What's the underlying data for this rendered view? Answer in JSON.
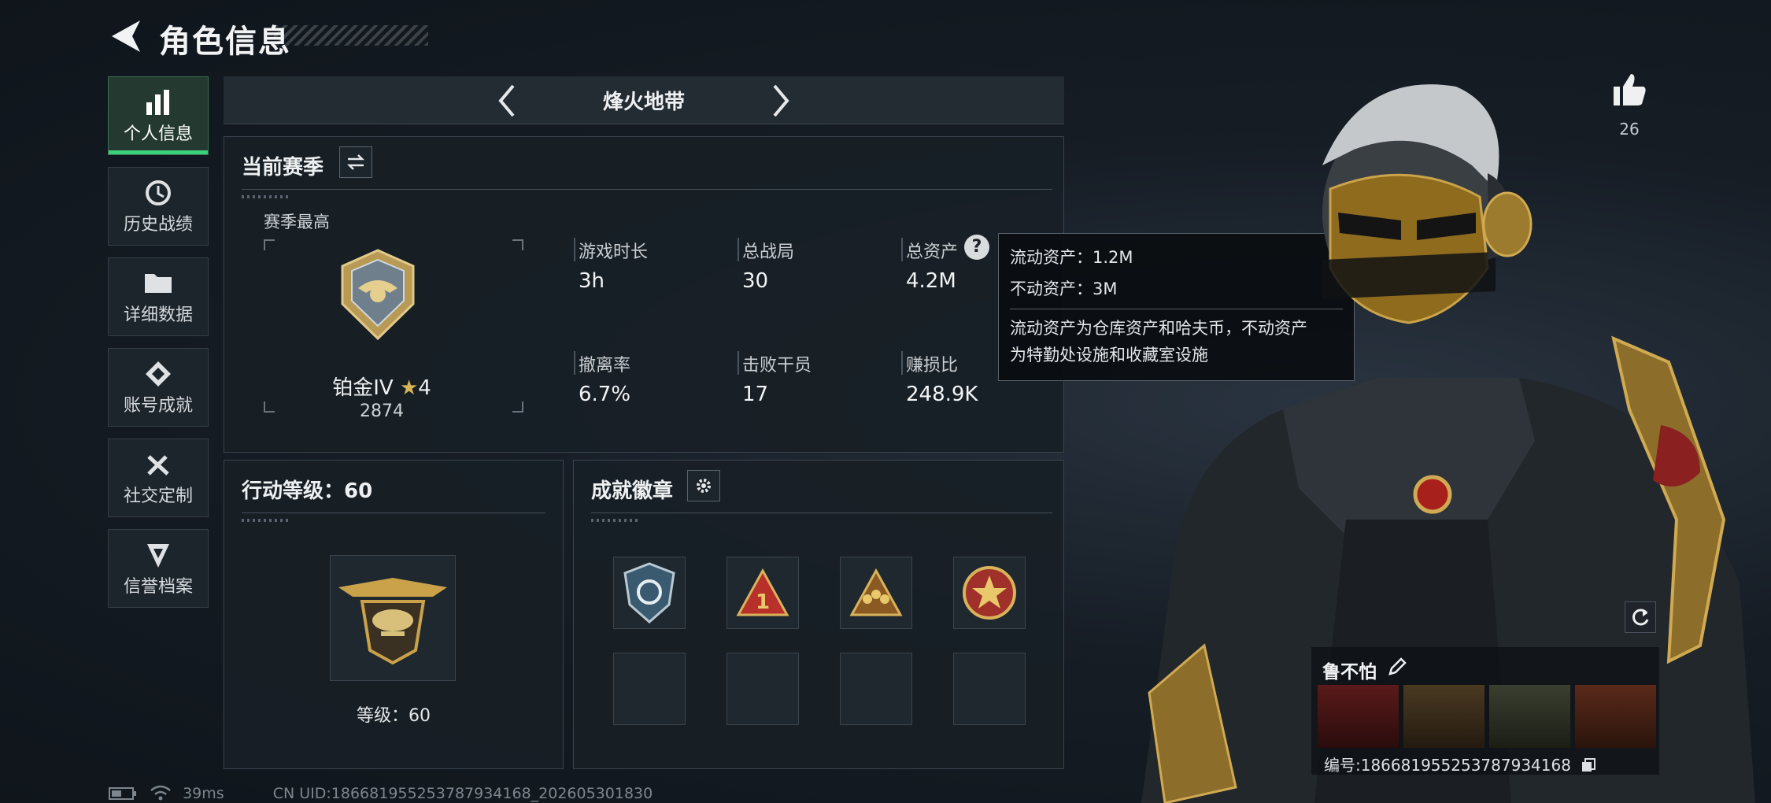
{
  "header": {
    "title": "角色信息"
  },
  "nav": {
    "items": [
      {
        "label": "个人信息",
        "icon": "bar-chart-icon",
        "active": true
      },
      {
        "label": "历史战绩",
        "icon": "history-clock-icon"
      },
      {
        "label": "详细数据",
        "icon": "folder-icon"
      },
      {
        "label": "账号成就",
        "icon": "achievement-icon"
      },
      {
        "label": "社交定制",
        "icon": "tools-icon"
      },
      {
        "label": "信誉档案",
        "icon": "reputation-icon"
      }
    ]
  },
  "map": {
    "name": "烽火地带"
  },
  "season": {
    "title": "当前赛季",
    "best_label": "赛季最高",
    "rank_name": "铂金IV",
    "rank_stars": "4",
    "rank_score": "2874",
    "stats": [
      {
        "label": "游戏时长",
        "value": "3h"
      },
      {
        "label": "总战局",
        "value": "30"
      },
      {
        "label": "总资产",
        "value": "4.2M"
      },
      {
        "label": "撤离率",
        "value": "6.7%"
      },
      {
        "label": "击败干员",
        "value": "17"
      },
      {
        "label": "赚损比",
        "value": "248.9K"
      }
    ]
  },
  "tooltip": {
    "line1": "流动资产：1.2M",
    "line2": "不动资产：3M",
    "desc1": "流动资产为仓库资产和哈夫币，不动资产",
    "desc2": "为特勤处设施和收藏室设施"
  },
  "level": {
    "title": "行动等级：60",
    "level_text": "等级：60"
  },
  "badges": {
    "title": "成就徽章",
    "filled": [
      "shield-badge-icon",
      "rank-one-badge-icon",
      "team-badge-icon",
      "star-emblem-badge-icon"
    ],
    "empty_slots": 4
  },
  "character": {
    "likes": "26",
    "name": "鲁不怕",
    "uid_label": "编号:1866819552537879341​68"
  },
  "status": {
    "ping": "39ms",
    "cn_uid": "CN UID:186681955253787934168_202605301830"
  },
  "colors": {
    "accent_green": "#3bd07a",
    "panel_bg": "#181f26",
    "gold": "#c9a24a"
  }
}
